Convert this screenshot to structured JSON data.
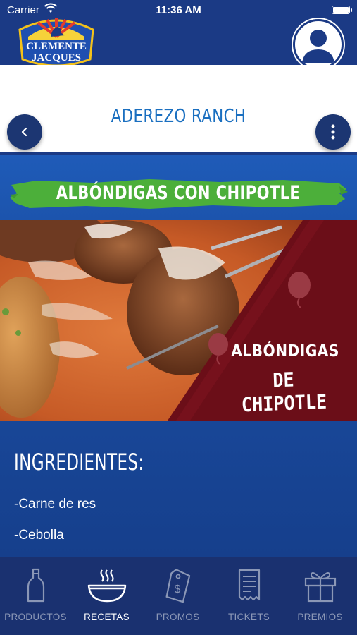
{
  "status_bar": {
    "carrier": "Carrier",
    "time": "11:36 AM"
  },
  "header": {
    "logo_line1": "CLEMENTE",
    "logo_line2": "JACQUES"
  },
  "page": {
    "title": "ADEREZO RANCH"
  },
  "recipe": {
    "banner_title": "ALBÓNDIGAS CON CHIPOTLE",
    "hero_title_line1": "ALBÓNDIGAS",
    "hero_title_line2": "DE CHIPOTLE"
  },
  "ingredients": {
    "heading": "INGREDIENTES:",
    "items": [
      "-Carne de res",
      "-Cebolla"
    ]
  },
  "tabs": [
    {
      "label": "PRODUCTOS",
      "icon": "bottle-icon",
      "active": false
    },
    {
      "label": "RECETAS",
      "icon": "bowl-icon",
      "active": true
    },
    {
      "label": "PROMOS",
      "icon": "tag-icon",
      "active": false
    },
    {
      "label": "TICKETS",
      "icon": "receipt-icon",
      "active": false
    },
    {
      "label": "PREMIOS",
      "icon": "gift-icon",
      "active": false
    }
  ],
  "colors": {
    "navy": "#1b3a85",
    "accent_blue": "#1a6fc0",
    "banner_green": "#4caf3a",
    "tab_inactive": "#8b97b6"
  }
}
